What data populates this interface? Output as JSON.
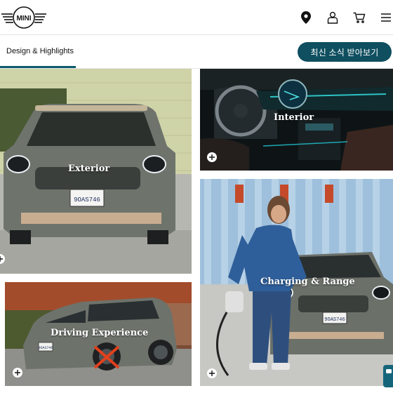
{
  "brand": {
    "logo_text": "MINI"
  },
  "header": {
    "icons": [
      "location-pin-icon",
      "user-icon",
      "cart-icon",
      "menu-icon"
    ]
  },
  "subnav": {
    "label": "Design & Highlights",
    "cta_label": "최신 소식 받아보기"
  },
  "tiles": {
    "exterior": {
      "title": "Exterior",
      "plate": "9OAS746"
    },
    "interior": {
      "title": "Interior"
    },
    "charging": {
      "title": "Charging & Range",
      "plate": "9OAS746"
    },
    "driving": {
      "title": "Driving Experience",
      "plate": "9OAS746"
    }
  },
  "colors": {
    "accent": "#0f4f5f",
    "underline": "#0f5b6e",
    "car_body": "#6e746c"
  }
}
